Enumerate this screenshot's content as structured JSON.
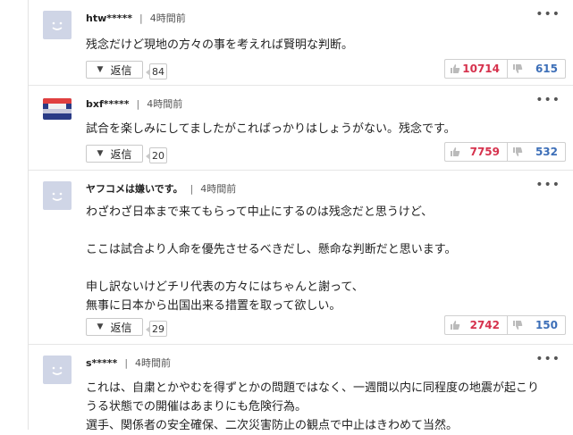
{
  "comments": [
    {
      "username": "htw*****",
      "time": "4時間前",
      "avatar": "default",
      "lines": [
        "残念だけど現地の方々の事を考えれば賢明な判断。"
      ],
      "reply_label": "返信",
      "reply_count": "84",
      "likes": "10714",
      "dislikes": "615"
    },
    {
      "username": "bxf*****",
      "time": "4時間前",
      "avatar": "photo",
      "lines": [
        "試合を楽しみにしてましたがこればっかりはしょうがない。残念です。"
      ],
      "reply_label": "返信",
      "reply_count": "20",
      "likes": "7759",
      "dislikes": "532"
    },
    {
      "username": "ヤフコメは嫌いです。",
      "time": "4時間前",
      "avatar": "default",
      "lines": [
        "わざわざ日本まで来てもらって中止にするのは残念だと思うけど、",
        "",
        "ここは試合より人命を優先させるべきだし、懸命な判断だと思います。",
        "",
        "申し訳ないけどチリ代表の方々にはちゃんと謝って、",
        "無事に日本から出国出来る措置を取って欲しい。"
      ],
      "reply_label": "返信",
      "reply_count": "29",
      "likes": "2742",
      "dislikes": "150"
    },
    {
      "username": "s*****",
      "time": "4時間前",
      "avatar": "default",
      "lines": [
        "これは、自粛とかやむを得ずとかの問題ではなく、一週間以内に同程度の地震が起こり",
        "うる状態での開催はあまりにも危険行為。",
        "選手、関係者の安全確保、二次災害防止の観点で中止はきわめて当然。"
      ]
    }
  ],
  "ui": {
    "separator": "|",
    "more": "•••",
    "reply_arrow": "▼",
    "thumb_up_icon": "thumbs-up-icon",
    "thumb_down_icon": "thumbs-down-icon",
    "good_color": "#d6324d",
    "bad_color": "#3d6fb8"
  }
}
